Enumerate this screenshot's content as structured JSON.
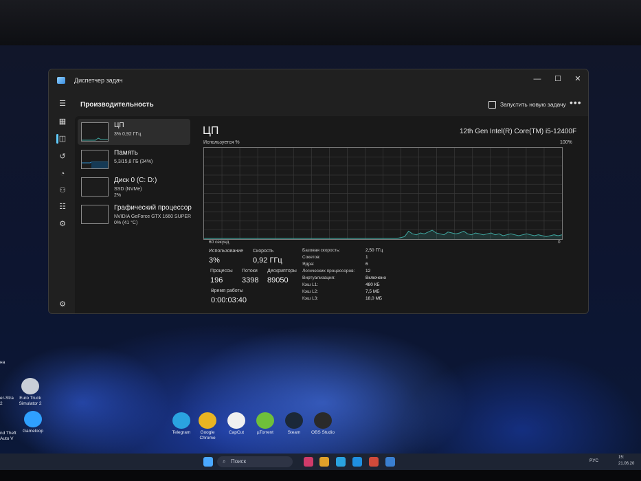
{
  "window": {
    "title": "Диспетчер задач",
    "minimize": "—",
    "maximize": "☐",
    "close": "✕"
  },
  "toolbar": {
    "section_title": "Производительность",
    "new_task_label": "Запустить новую задачу",
    "more_label": "•••"
  },
  "nav": {
    "menu_icon": "hamburger-icon",
    "items": [
      "processes-icon",
      "performance-icon",
      "app-history-icon",
      "startup-icon",
      "users-icon",
      "details-icon",
      "services-icon"
    ],
    "settings_icon": "gear-icon"
  },
  "devices": [
    {
      "name": "ЦП",
      "sub1": "3% 0,92 ГГц",
      "sub2": ""
    },
    {
      "name": "Память",
      "sub1": "5,3/15,8 ГБ (34%)",
      "sub2": ""
    },
    {
      "name": "Диск 0 (C: D:)",
      "sub1": "SSD (NVMe)",
      "sub2": "2%"
    },
    {
      "name": "Графический процессор",
      "sub1": "NVIDIA GeForce GTX 1660 SUPER",
      "sub2": "0% (41 °C)"
    }
  ],
  "cpu": {
    "title": "ЦП",
    "model": "12th Gen Intel(R) Core(TM) i5-12400F",
    "graph_label": "Используется %",
    "graph_max": "100%",
    "graph_time": "60 секунд",
    "graph_min": "0"
  },
  "stats": {
    "usage_label": "Использование",
    "usage_value": "3%",
    "speed_label": "Скорость",
    "speed_value": "0,92 ГГц",
    "processes_label": "Процессы",
    "processes_value": "196",
    "threads_label": "Потоки",
    "threads_value": "3398",
    "handles_label": "Дескрипторы",
    "handles_value": "89050",
    "uptime_label": "Время работы",
    "uptime_value": "0:00:03:40"
  },
  "specs": [
    {
      "label": "Базовая скорость:",
      "value": "2,50 ГГц"
    },
    {
      "label": "Сокетов:",
      "value": "1"
    },
    {
      "label": "Ядра:",
      "value": "6"
    },
    {
      "label": "Логических процессоров:",
      "value": "12"
    },
    {
      "label": "Виртуализация:",
      "value": "Включено"
    },
    {
      "label": "Кэш L1:",
      "value": "480 КБ"
    },
    {
      "label": "Кэш L2:",
      "value": "7,5 МБ"
    },
    {
      "label": "Кэш L3:",
      "value": "18,0 МБ"
    }
  ],
  "cpu_history_percent": [
    0,
    0,
    0,
    0,
    0,
    0,
    0,
    0,
    0,
    0,
    0,
    0,
    0,
    0,
    0,
    0,
    0,
    0,
    0,
    0,
    0,
    0,
    0,
    0,
    0,
    0,
    0,
    0,
    0,
    0,
    0,
    0,
    0,
    0,
    0,
    0,
    0,
    0,
    0,
    0,
    0,
    0,
    0,
    0,
    0,
    0,
    0,
    0,
    0,
    0,
    1,
    2,
    8,
    5,
    4,
    6,
    5,
    7,
    9,
    6,
    5,
    4,
    7,
    6,
    5,
    6,
    8,
    5,
    4,
    6,
    5,
    4,
    5,
    6,
    4,
    5,
    3,
    4,
    5,
    4,
    3,
    4,
    5,
    4,
    3,
    4,
    3,
    2,
    3,
    4,
    3,
    4
  ],
  "desktop": {
    "left_labels": [
      "нa",
      "er-Stra\n2",
      "nd Theft\nAuto V"
    ],
    "icons": [
      {
        "label": "Euro Truck\nSimulator 2",
        "color": "#c9cfd8"
      },
      {
        "label": "Gameloop",
        "color": "#2fa0ff"
      },
      {
        "label": "Telegram",
        "color": "#2aa3e0"
      },
      {
        "label": "Google\nChrome",
        "color": "#e8b422"
      },
      {
        "label": "CapCut",
        "color": "#f0f0f0"
      },
      {
        "label": "µTorrent",
        "color": "#6fbf3a"
      },
      {
        "label": "Steam",
        "color": "#1b2838"
      },
      {
        "label": "OBS Studio",
        "color": "#2a2a2a"
      }
    ]
  },
  "taskbar": {
    "search_placeholder": "Поиск",
    "search_icon": "search-icon",
    "language": "РУС",
    "time": "15:",
    "date": "21.06.20"
  },
  "colors": {
    "graph_line": "#3fa7a0",
    "graph_grid": "#3a3a3a",
    "accent": "#60cdff"
  }
}
